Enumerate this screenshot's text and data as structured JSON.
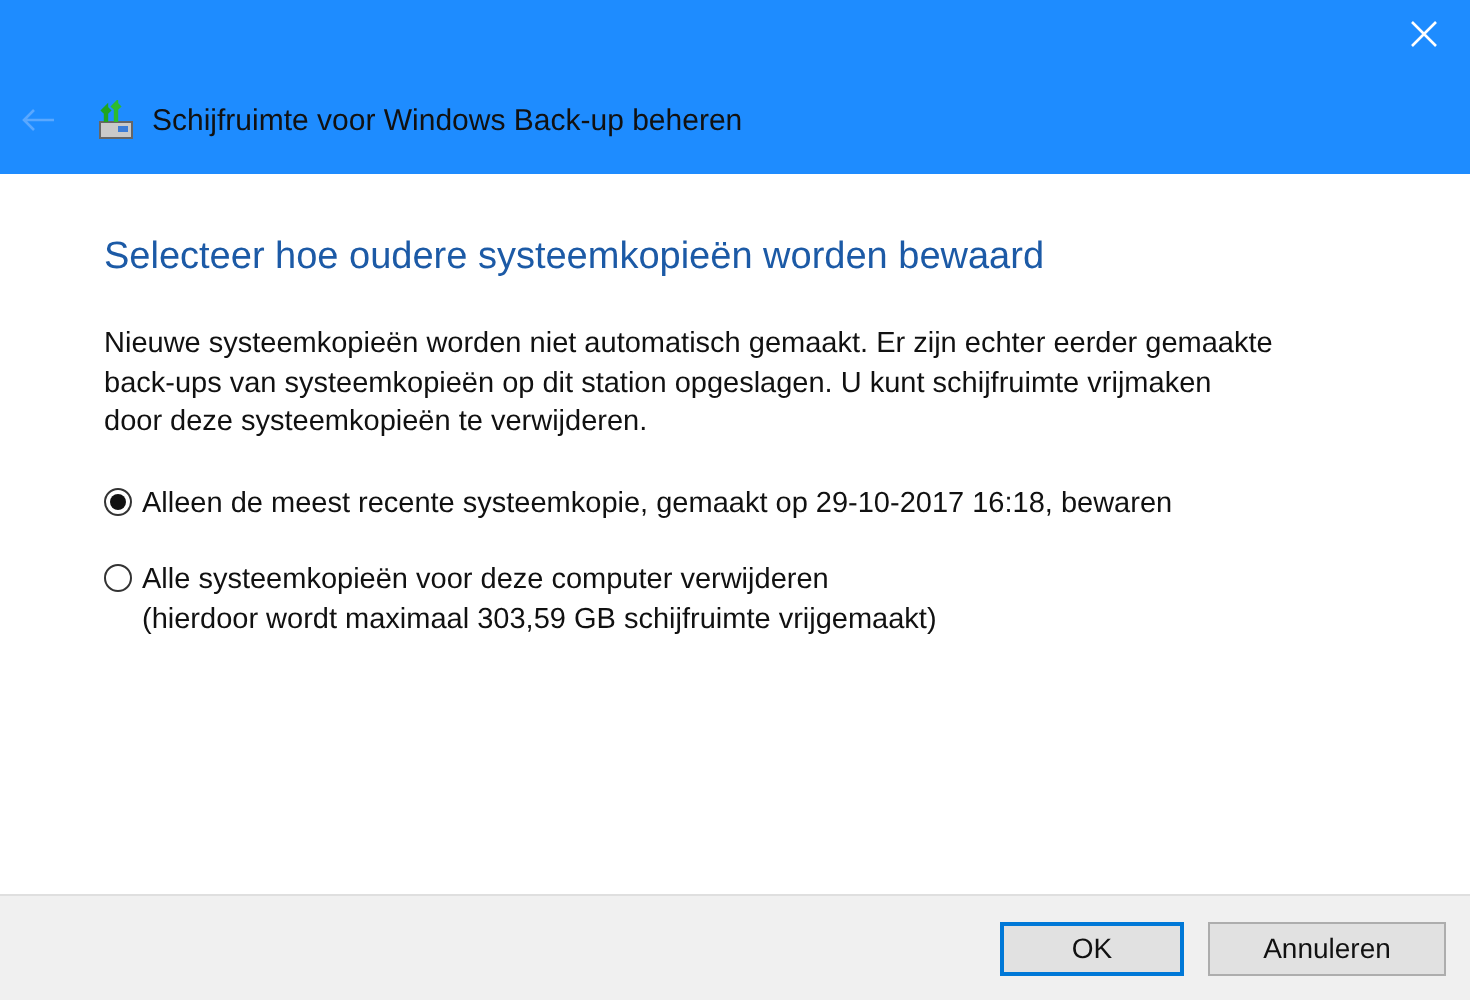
{
  "window": {
    "title": "Schijfruimte voor Windows Back-up beheren",
    "back_disabled": true
  },
  "heading": "Selecteer hoe oudere systeemkopieën worden bewaard",
  "description": "Nieuwe systeemkopieën worden niet automatisch gemaakt. Er zijn echter eerder gemaakte back-ups van systeemkopieën op dit station opgeslagen. U kunt schijfruimte vrijmaken door deze systeemkopieën te verwijderen.",
  "options": [
    {
      "label": "Alleen de meest recente systeemkopie, gemaakt op 29-10-2017 16:18, bewaren",
      "selected": true
    },
    {
      "label": "Alle systeemkopieën voor deze computer verwijderen",
      "note": "(hierdoor wordt maximaal 303,59 GB schijfruimte vrijgemaakt)",
      "selected": false
    }
  ],
  "buttons": [
    {
      "label": "OK",
      "default": true
    },
    {
      "label": "Annuleren",
      "default": false
    }
  ]
}
